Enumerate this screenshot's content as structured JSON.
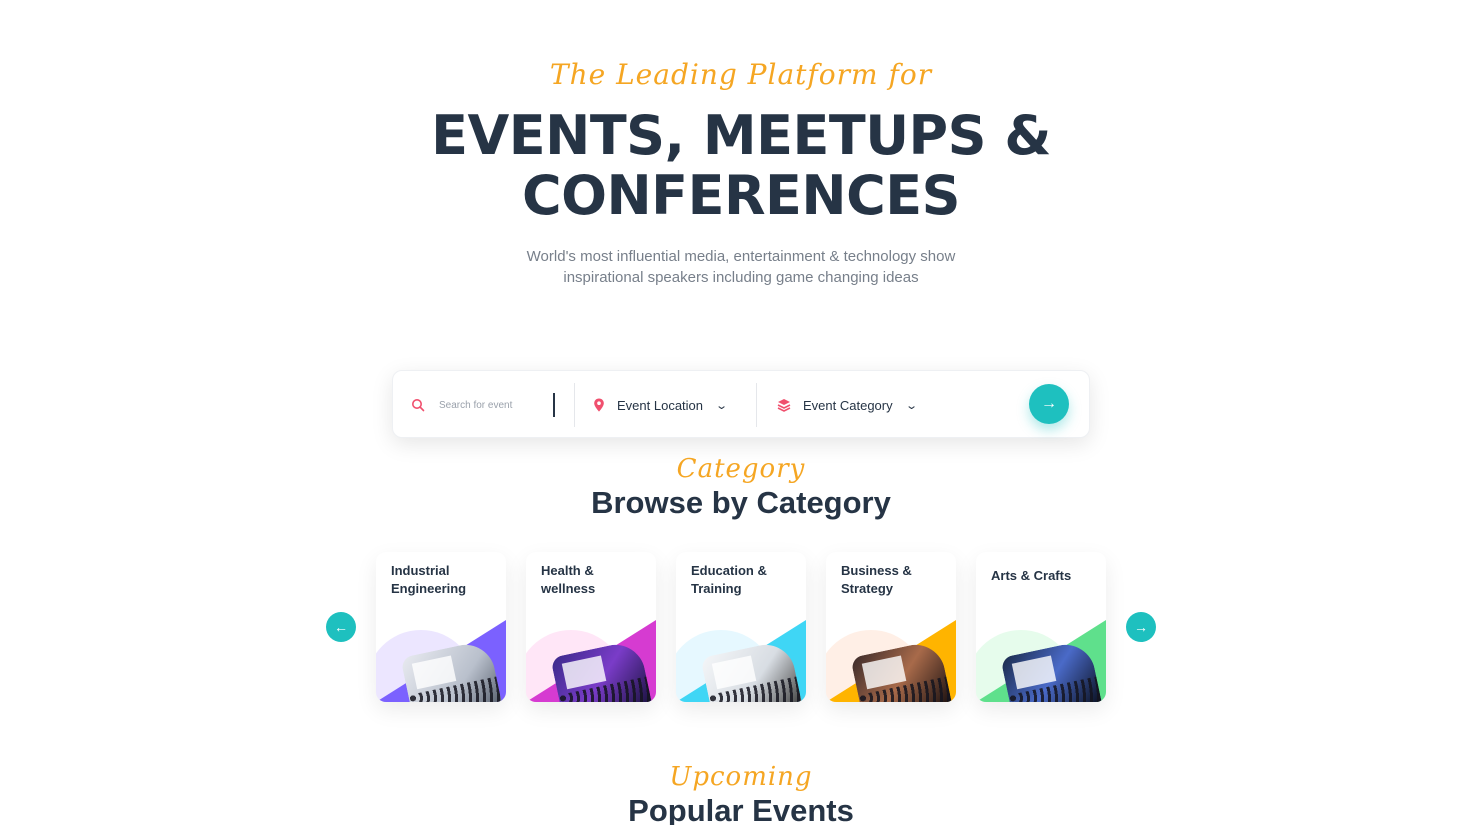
{
  "hero": {
    "tagline": "The Leading Platform for",
    "title_line1": "EVENTS, MEETUPS &",
    "title_line2": "CONFERENCES",
    "subtitle_line1": "World's most influential media, entertainment & technology show",
    "subtitle_line2": "inspirational speakers including game changing ideas"
  },
  "search": {
    "placeholder": "Search for event",
    "location_label": "Event Location",
    "category_label": "Event Category",
    "icons": {
      "search": "search-icon",
      "location": "location-pin-icon",
      "category": "layers-icon",
      "submit": "arrow-right-icon"
    }
  },
  "category_section": {
    "tagline": "Category",
    "title": "Browse by Category",
    "prev_icon": "←",
    "next_icon": "→",
    "items": [
      {
        "name": "Industrial Engineering",
        "accent": "#7b61ff",
        "blob": "#c8b8ff"
      },
      {
        "name": "Health & wellness",
        "accent": "#d63bd1",
        "blob": "#ffb6e8"
      },
      {
        "name": "Education & Training",
        "accent": "#3fd6f5",
        "blob": "#b8ecff"
      },
      {
        "name": "Business & Strategy",
        "accent": "#ffb400",
        "blob": "#ffd2b8"
      },
      {
        "name": "Arts & Crafts",
        "accent": "#5fe08c",
        "blob": "#b8f5c8"
      }
    ]
  },
  "upcoming_section": {
    "tagline": "Upcoming",
    "title": "Popular Events"
  },
  "colors": {
    "accent_teal": "#1ec0bf",
    "script_orange": "#f5a623",
    "heading": "#263445",
    "icon_pink": "#f0506e"
  }
}
